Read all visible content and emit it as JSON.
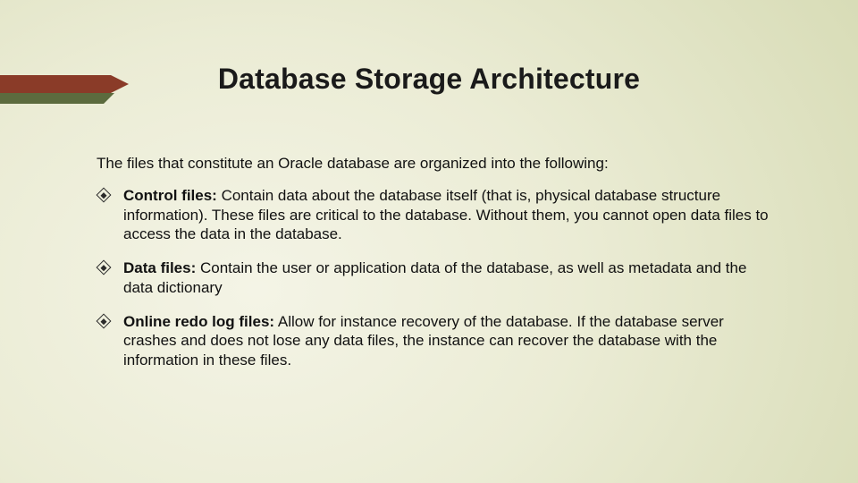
{
  "title": "Database Storage Architecture",
  "intro": "The files that constitute an Oracle database are organized into the following:",
  "items": [
    {
      "term": "Control files:",
      "desc": " Contain data about the database itself (that is, physical database structure information). These files are critical to the database. Without them, you cannot open data files to access the data in the database."
    },
    {
      "term": "Data files:",
      "desc": " Contain the user or application data of the database, as well as metadata and the data dictionary"
    },
    {
      "term": "Online redo log files:",
      "desc": " Allow for instance recovery of the database. If the database server crashes and does not lose any data files, the instance can recover the database with the information in these files."
    }
  ]
}
